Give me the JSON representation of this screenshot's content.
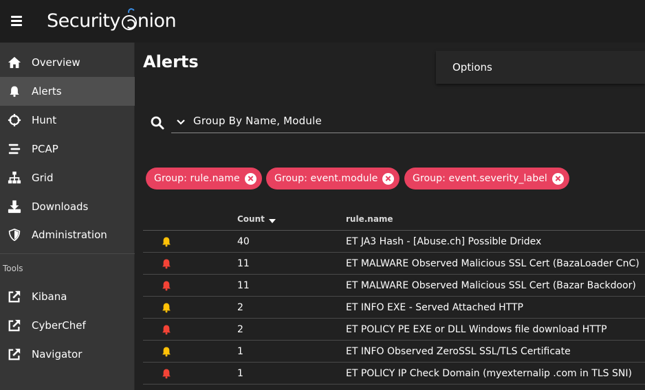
{
  "app": {
    "logo_text_a": "Security",
    "logo_text_b": "nion",
    "logo_accent": "#3a8ee6"
  },
  "sidebar": {
    "items": [
      {
        "label": "Overview",
        "icon": "home-icon",
        "active": false
      },
      {
        "label": "Alerts",
        "icon": "bell-icon",
        "active": true
      },
      {
        "label": "Hunt",
        "icon": "crosshairs-icon",
        "active": false
      },
      {
        "label": "PCAP",
        "icon": "stream-icon",
        "active": false
      },
      {
        "label": "Grid",
        "icon": "sitemap-icon",
        "active": false
      },
      {
        "label": "Downloads",
        "icon": "download-icon",
        "active": false
      },
      {
        "label": "Administration",
        "icon": "shield-icon",
        "active": false
      }
    ],
    "tools_header": "Tools",
    "tools": [
      {
        "label": "Kibana",
        "icon": "external-link-icon"
      },
      {
        "label": "CyberChef",
        "icon": "external-link-icon"
      },
      {
        "label": "Navigator",
        "icon": "external-link-icon"
      }
    ]
  },
  "main": {
    "title": "Alerts",
    "options_label": "Options",
    "search_value": "Group By Name, Module",
    "chips": [
      "Group: rule.name",
      "Group: event.module",
      "Group: event.severity_label"
    ],
    "chip_color": "#e8415f",
    "table": {
      "headers": {
        "count": "Count",
        "name": "rule.name"
      },
      "rows": [
        {
          "severity": "medium",
          "count": "40",
          "name": "ET JA3 Hash - [Abuse.ch] Possible Dridex"
        },
        {
          "severity": "high",
          "count": "11",
          "name": "ET MALWARE Observed Malicious SSL Cert (BazaLoader CnC)"
        },
        {
          "severity": "high",
          "count": "11",
          "name": "ET MALWARE Observed Malicious SSL Cert (Bazar Backdoor)"
        },
        {
          "severity": "medium",
          "count": "2",
          "name": "ET INFO EXE - Served Attached HTTP"
        },
        {
          "severity": "high",
          "count": "2",
          "name": "ET POLICY PE EXE or DLL Windows file download HTTP"
        },
        {
          "severity": "medium",
          "count": "1",
          "name": "ET INFO Observed ZeroSSL SSL/TLS Certificate"
        },
        {
          "severity": "high",
          "count": "1",
          "name": "ET POLICY IP Check Domain (myexternalip .com in TLS SNI)"
        }
      ],
      "severity_colors": {
        "high": "#f44336",
        "medium": "#ffc107"
      }
    }
  }
}
